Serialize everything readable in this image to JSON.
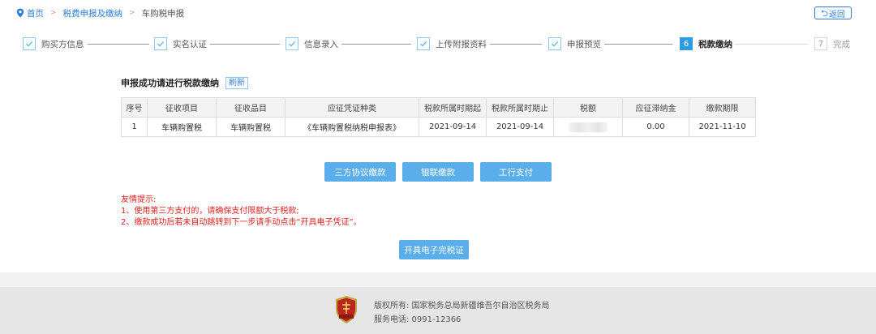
{
  "breadcrumb": {
    "home": "首页",
    "section": "税费申报及缴纳",
    "current": "车购税申报"
  },
  "back_label": "返回",
  "steps": [
    {
      "label": "购买方信息",
      "state": "done"
    },
    {
      "label": "实名认证",
      "state": "done"
    },
    {
      "label": "信息录入",
      "state": "done"
    },
    {
      "label": "上传附报资料",
      "state": "done"
    },
    {
      "label": "申报预览",
      "state": "done"
    },
    {
      "number": "6",
      "label": "税款缴纳",
      "state": "active"
    },
    {
      "number": "7",
      "label": "完成",
      "state": "todo"
    }
  ],
  "main": {
    "title": "申报成功请进行税款缴纳",
    "refresh_label": "刷新"
  },
  "table": {
    "headers": [
      "序号",
      "征收项目",
      "征收品目",
      "应征凭证种类",
      "税款所属时期起",
      "税款所属时期止",
      "税额",
      "应征滞纳金",
      "缴款期限"
    ],
    "rows": [
      {
        "index": "1",
        "item": "车辆购置税",
        "category": "车辆购置税",
        "voucher": "《车辆购置税纳税申报表》",
        "period_start": "2021-09-14",
        "period_end": "2021-09-14",
        "late_fee": "0.00",
        "deadline": "2021-11-10"
      }
    ]
  },
  "payment_buttons": {
    "tripartite": "三方协议缴款",
    "unionpay": "银联缴款",
    "icbc": "工行支付"
  },
  "notice": {
    "heading": "友情提示:",
    "line1": "1、使用第三方支付的，请确保支付限额大于税款;",
    "line2": "2、缴款成功后若未自动跳转到下一步请手动点击“开具电子凭证”。"
  },
  "certificate_button": "开具电子完税证",
  "footer": {
    "copyright": "版权所有: 国家税务总局新疆维吾尔自治区税务局",
    "phone": "服务电话: 0991-12366"
  },
  "colors": {
    "accent": "#2e7cd6",
    "button": "#5aaeea",
    "notice": "#e02020"
  }
}
